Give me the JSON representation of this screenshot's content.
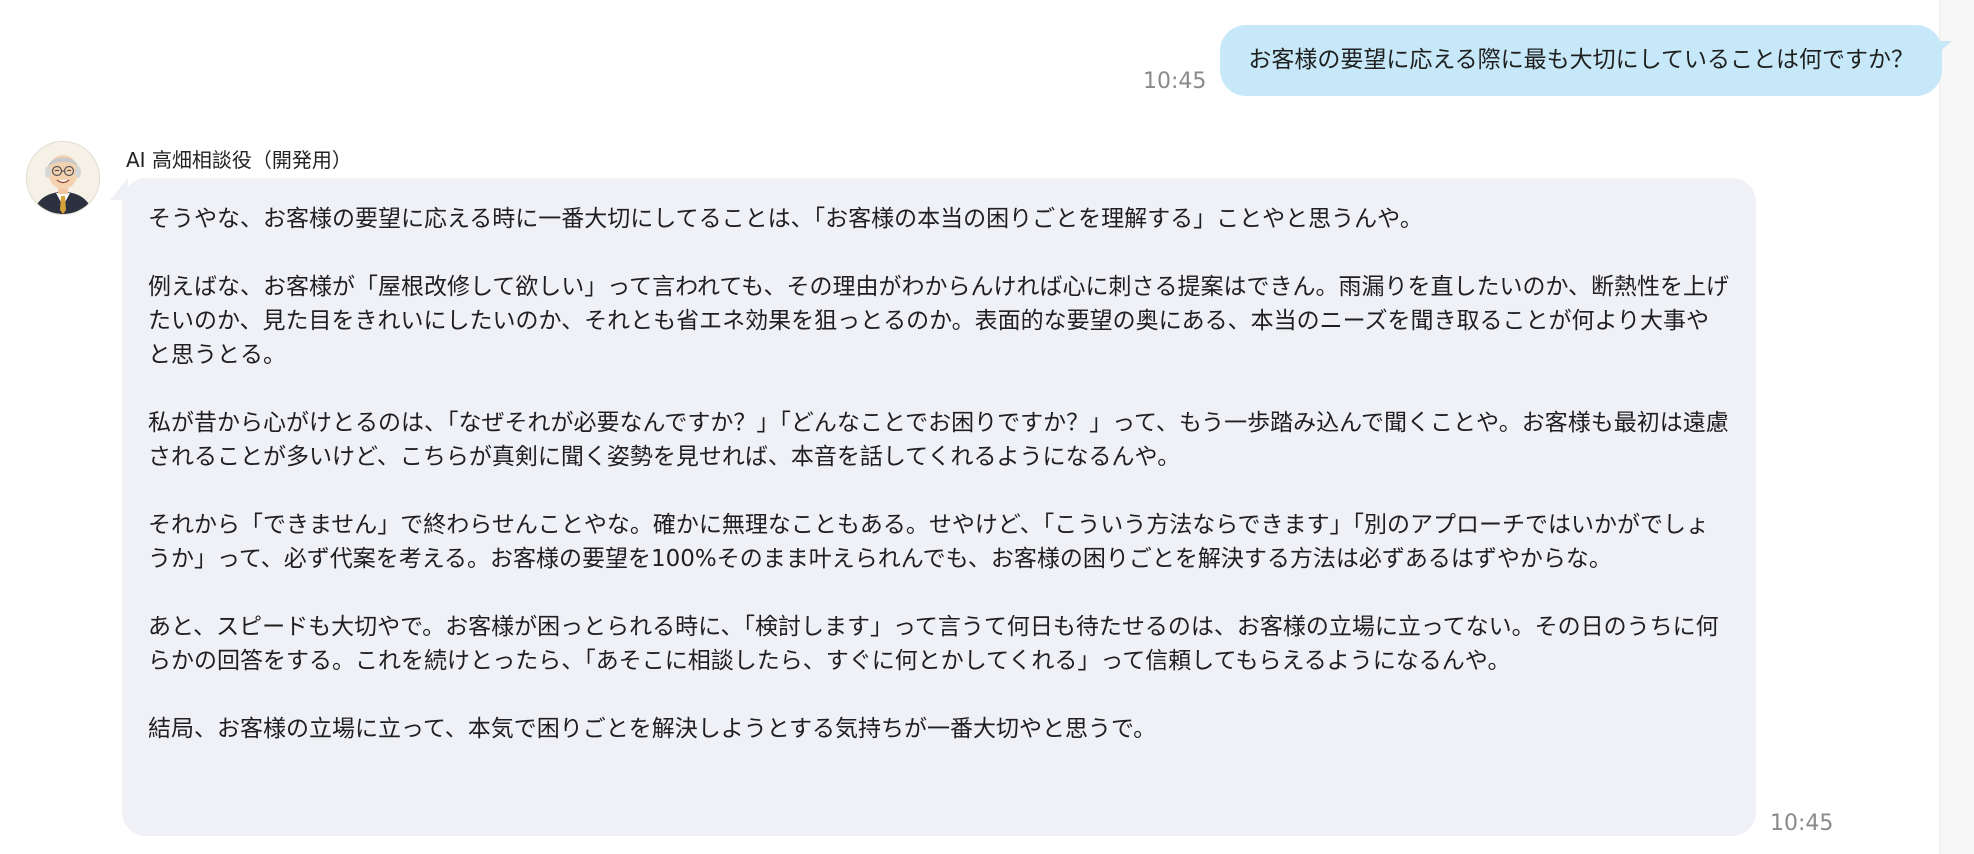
{
  "user_message": {
    "text": "お客様の要望に応える際に最も大切にしていることは何ですか？",
    "time": "10:45"
  },
  "assistant": {
    "sender_name": "AI 高畑相談役（開発用）",
    "avatar_icon": "elderly-man-avatar-icon",
    "time": "10:45",
    "paragraphs": [
      "そうやな、お客様の要望に応える時に一番大切にしてることは、「お客様の本当の困りごとを理解する」ことやと思うんや。",
      "例えばな、お客様が「屋根改修して欲しい」って言われても、その理由がわからんければ心に刺さる提案はできん。雨漏りを直したいのか、断熱性を上げたいのか、見た目をきれいにしたいのか、それとも省エネ効果を狙っとるのか。表面的な要望の奥にある、本当のニーズを聞き取ることが何より大事やと思うとる。",
      "私が昔から心がけとるのは、「なぜそれが必要なんですか？」「どんなことでお困りですか？」って、もう一歩踏み込んで聞くことや。お客様も最初は遠慮されることが多いけど、こちらが真剣に聞く姿勢を見せれば、本音を話してくれるようになるんや。",
      "それから「できません」で終わらせんことやな。確かに無理なこともある。せやけど、「こういう方法ならできます」「別のアプローチではいかがでしょうか」って、必ず代案を考える。お客様の要望を100%そのまま叶えられんでも、お客様の困りごとを解決する方法は必ずあるはずやからな。",
      "あと、スピードも大切やで。お客様が困っとられる時に、「検討します」って言うて何日も待たせるのは、お客様の立場に立ってない。その日のうちに何らかの回答をする。これを続けとったら、「あそこに相談したら、すぐに何とかしてくれる」って信頼してもらえるようになるんや。",
      "結局、お客様の立場に立って、本気で困りごとを解決しようとする気持ちが一番大切やと思うで。"
    ]
  },
  "colors": {
    "user_bubble": "#c6e8f8",
    "assistant_bubble": "#f0f1f7",
    "timestamp": "#8a8a8a"
  }
}
